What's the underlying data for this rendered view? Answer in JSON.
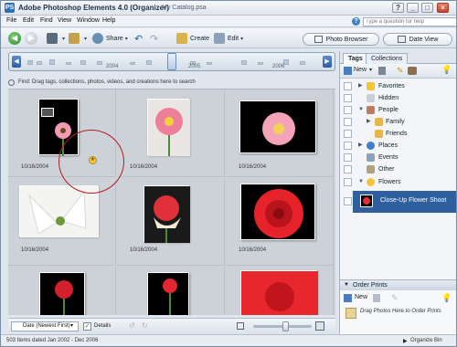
{
  "app": {
    "title": "Adobe Photoshop Elements 4.0 (Organizer)",
    "catalog": "My Catalog.psa",
    "icon_text": "PS"
  },
  "window_buttons": {
    "help": "?",
    "minimize": "_",
    "maximize": "□",
    "close": "×"
  },
  "menu": [
    "File",
    "Edit",
    "Find",
    "View",
    "Window",
    "Help"
  ],
  "help_search": {
    "placeholder": "Type a question for help",
    "icon": "?"
  },
  "toolbar": {
    "back": "◀",
    "forward": "▶",
    "share_label": "Share",
    "create_label": "Create",
    "edit_label": "Edit",
    "photo_browser_label": "Photo Browser",
    "date_view_label": "Date View"
  },
  "timeline": {
    "years": [
      "2004",
      "2005",
      "2006"
    ]
  },
  "find_hint": "Find: Drag tags, collections, photos, videos, and creations here to search",
  "photos": [
    {
      "date": "10/16/2004",
      "type": "gerbera-white"
    },
    {
      "date": "10/16/2004",
      "type": "gerbera-pink"
    },
    {
      "date": "10/16/2004",
      "type": "gerbera-black"
    },
    {
      "date": "10/16/2004",
      "type": "lily"
    },
    {
      "date": "10/16/2004",
      "type": "rose-white"
    },
    {
      "date": "10/16/2004",
      "type": "rose-red"
    },
    {
      "date": "",
      "type": "rose-dark"
    },
    {
      "date": "",
      "type": "rose-stem"
    },
    {
      "date": "",
      "type": "rose-big"
    }
  ],
  "bottom_controls": {
    "sort_label": "Date (Newest First)",
    "details_label": "Details",
    "details_checked": true
  },
  "status": {
    "left": "503 Items dated Jan 2002 - Dec 2006",
    "right": "Organize Bin"
  },
  "panel": {
    "tabs": [
      "Tags",
      "Collections"
    ],
    "new_label": "New",
    "tags": [
      {
        "label": "Favorites",
        "icon": "star-icon",
        "level": 1,
        "expander": true
      },
      {
        "label": "Hidden",
        "icon": "hidden-icon",
        "level": 1,
        "expander": false
      },
      {
        "label": "People",
        "icon": "people-icon",
        "level": 1,
        "expander": true
      },
      {
        "label": "Family",
        "icon": "folder-icon",
        "level": 2,
        "expander": true
      },
      {
        "label": "Friends",
        "icon": "folder-icon",
        "level": 2,
        "expander": false
      },
      {
        "label": "Places",
        "icon": "globe-icon",
        "level": 1,
        "expander": true
      },
      {
        "label": "Events",
        "icon": "events-icon",
        "level": 1,
        "expander": false
      },
      {
        "label": "Other",
        "icon": "other-icon",
        "level": 1,
        "expander": false
      },
      {
        "label": "Flowers",
        "icon": "flower-icon",
        "level": 1,
        "expander": true
      }
    ],
    "selected_tag": "Close-Up Flower Shoot",
    "order_prints_label": "Order Prints",
    "order_new_label": "New",
    "order_drop_hint": "Drag Photos Here to Order Prints"
  },
  "colors": {
    "accent": "#2f5f9e",
    "highlight_ring": "#b21d25",
    "grid_bg": "#cdd2d8"
  }
}
